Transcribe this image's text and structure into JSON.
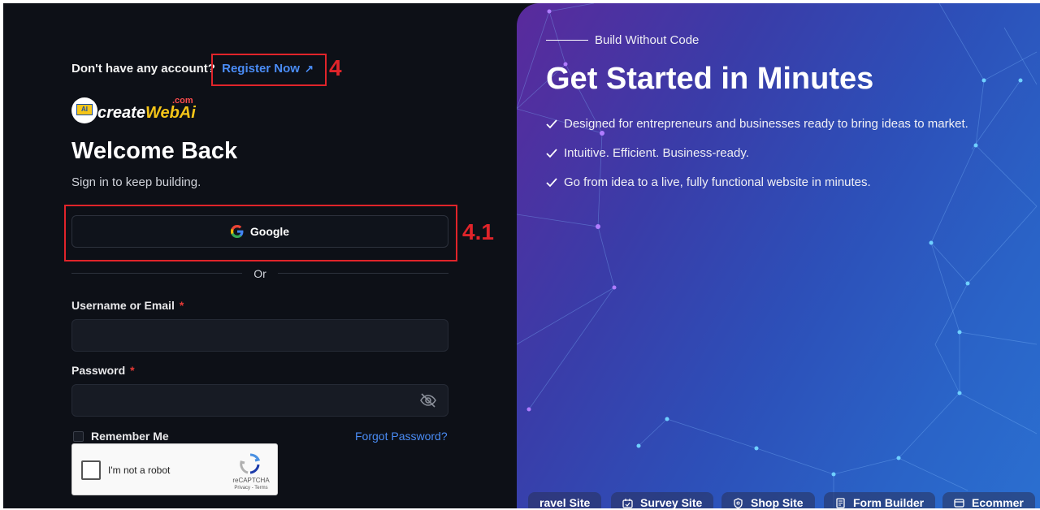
{
  "login": {
    "no_account_text": "Don't have any account?",
    "register_link": "Register Now",
    "register_arrow": "↗",
    "logo": {
      "main_prefix": "create",
      "main_web": "Web",
      "main_ai": "Ai",
      "suffix": ".com",
      "badge": "AI"
    },
    "title": "Welcome Back",
    "subtitle": "Sign in to keep building.",
    "google_button": "Google",
    "divider_text": "Or",
    "username_label": "Username or Email",
    "username_value": "",
    "password_label": "Password",
    "password_value": "",
    "required_mark": "*",
    "remember_label": "Remember Me",
    "forgot_link": "Forgot Password?",
    "captcha": {
      "label": "I'm not a robot",
      "brand": "reCAPTCHA",
      "links": "Privacy - Terms"
    }
  },
  "annotations": {
    "register_marker": "4",
    "google_marker": "4.1"
  },
  "hero": {
    "eyebrow": "Build Without Code",
    "headline": "Get Started in Minutes",
    "features": [
      "Designed for entrepreneurs and businesses ready to bring ideas to market.",
      "Intuitive. Efficient. Business-ready.",
      "Go from idea to a live, fully functional website in minutes."
    ],
    "chips": [
      {
        "label": "ravel Site",
        "icon": "travel-icon"
      },
      {
        "label": "Survey Site",
        "icon": "survey-icon"
      },
      {
        "label": "Shop Site",
        "icon": "shield-icon"
      },
      {
        "label": "Form Builder",
        "icon": "document-icon"
      },
      {
        "label": "Ecommer",
        "icon": "window-icon"
      }
    ]
  },
  "colors": {
    "accent_link": "#4a8cf5",
    "annotation_red": "#e0242a",
    "panel_dark": "#0d1017"
  }
}
